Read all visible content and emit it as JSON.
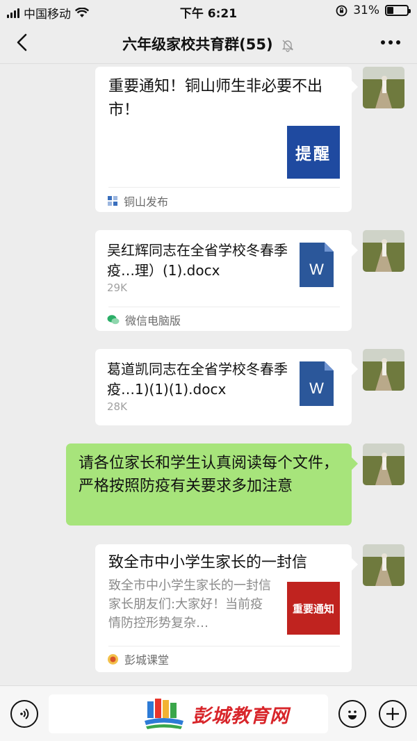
{
  "status_bar": {
    "carrier": "中国移动",
    "time": "下午 6:21",
    "battery": "31%",
    "battery_level": 0.31
  },
  "header": {
    "title": "六年级家校共育群(55)"
  },
  "messages": [
    {
      "type": "link",
      "title": "重要通知！铜山师生非必要不出市！",
      "thumb_text": "提醒",
      "source": "铜山发布"
    },
    {
      "type": "file",
      "file_name": "吴红辉同志在全省学校冬春季疫…理）(1).docx",
      "file_size": "29K",
      "source": "微信电脑版"
    },
    {
      "type": "file",
      "file_name": "葛道凯同志在全省学校冬春季疫…1)(1)(1).docx",
      "file_size": "28K"
    },
    {
      "type": "text",
      "text": "请各位家长和学生认真阅读每个文件，严格按照防疫有关要求多加注意"
    },
    {
      "type": "link",
      "title": "致全市中小学生家长的一封信",
      "description": "致全市中小学生家长的一封信家长朋友们:大家好！当前疫情防控形势复杂…",
      "thumb_text": "重要通知",
      "source": "彭城课堂"
    }
  ],
  "watermark": {
    "text": "彭城教育网"
  },
  "colors": {
    "bubble_green": "#a7e47b",
    "thumb_blue": "#1f4aa0",
    "thumb_red": "#c0231f",
    "word_blue": "#2b579a",
    "background": "#ededed"
  }
}
